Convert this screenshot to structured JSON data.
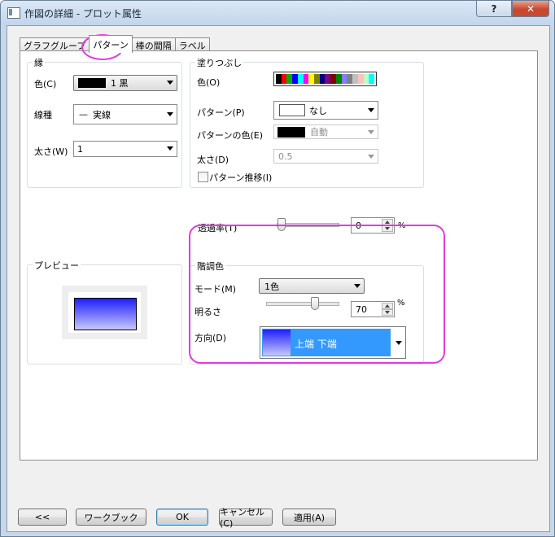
{
  "window": {
    "title": "作図の詳細 - プロット属性",
    "help_glyph": "?",
    "close_glyph": "✕"
  },
  "tabs": [
    {
      "label": "グラフグループ",
      "active": false
    },
    {
      "label": "パターン",
      "active": true
    },
    {
      "label": "棒の間隔",
      "active": false
    },
    {
      "label": "ラベル",
      "active": false
    }
  ],
  "border_group": {
    "title": "縁",
    "color_label": "色(C)",
    "color_value": "1 黒",
    "color_swatch": "#000000",
    "style_label": "線種",
    "style_glyph": "—",
    "style_value": "実線",
    "width_label": "太さ(W)",
    "width_value": "1"
  },
  "fill_group": {
    "title": "塗りつぶし",
    "color_label": "色(O)",
    "palette_colors": [
      "#000000",
      "#ff0000",
      "#00b000",
      "#0000ff",
      "#00ffff",
      "#ff00ff",
      "#ffff00",
      "#808000",
      "#000080",
      "#800080",
      "#800000",
      "#008000",
      "#7f7fff",
      "#808080",
      "#c0c0c0",
      "#ffc0c0",
      "#c0ffc0",
      "#00ffff"
    ],
    "pattern_label": "パターン(P)",
    "pattern_value": "なし",
    "pattern_color_label": "パターンの色(E)",
    "pattern_color_value": "自動",
    "pattern_color_swatch": "#000000",
    "width_label": "太さ(D)",
    "width_value": "0.5",
    "increment_label": "パターン推移(I)",
    "increment_checked": false
  },
  "transparency": {
    "label": "透過率(T)",
    "value": "0",
    "percent": 0,
    "unit": "%"
  },
  "preview": {
    "title": "プレビュー"
  },
  "gradient_group": {
    "title": "階調色",
    "mode_label": "モード(M)",
    "mode_value": "1色",
    "brightness_label": "明るさ",
    "brightness_value": "70",
    "brightness_percent": 70,
    "unit": "%",
    "direction_label": "方向(D)",
    "direction_value": "上端 下端"
  },
  "buttons": {
    "prev": "<<",
    "workbook": "ワークブック",
    "ok": "OK",
    "cancel": "キャンセル(C)",
    "apply": "適用(A)"
  },
  "colors": {
    "highlight": "#e23ce2",
    "gradient_start": "#1e1eff",
    "gradient_end": "#c7c7ff",
    "selection": "#3399ff"
  }
}
